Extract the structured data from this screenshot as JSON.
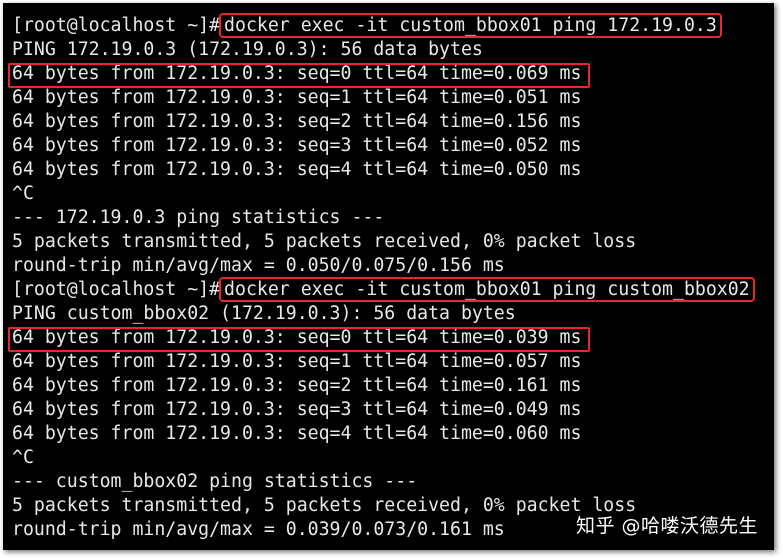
{
  "terminal": {
    "lines": [
      {
        "prompt": "[root@localhost ~]#",
        "command": "docker exec -it custom_bbox01 ping 172.19.0.3"
      },
      {
        "text": "PING 172.19.0.3 (172.19.0.3): 56 data bytes"
      },
      {
        "text": "64 bytes from 172.19.0.3: seq=0 ttl=64 time=0.069 ms"
      },
      {
        "text": "64 bytes from 172.19.0.3: seq=1 ttl=64 time=0.051 ms"
      },
      {
        "text": "64 bytes from 172.19.0.3: seq=2 ttl=64 time=0.156 ms"
      },
      {
        "text": "64 bytes from 172.19.0.3: seq=3 ttl=64 time=0.052 ms"
      },
      {
        "text": "64 bytes from 172.19.0.3: seq=4 ttl=64 time=0.050 ms"
      },
      {
        "text": "^C"
      },
      {
        "text": "--- 172.19.0.3 ping statistics ---"
      },
      {
        "text": "5 packets transmitted, 5 packets received, 0% packet loss"
      },
      {
        "text": "round-trip min/avg/max = 0.050/0.075/0.156 ms"
      },
      {
        "prompt": "[root@localhost ~]#",
        "command": "docker exec -it custom_bbox01 ping custom_bbox02"
      },
      {
        "text": "PING custom_bbox02 (172.19.0.3): 56 data bytes"
      },
      {
        "text": "64 bytes from 172.19.0.3: seq=0 ttl=64 time=0.039 ms"
      },
      {
        "text": "64 bytes from 172.19.0.3: seq=1 ttl=64 time=0.057 ms"
      },
      {
        "text": "64 bytes from 172.19.0.3: seq=2 ttl=64 time=0.161 ms"
      },
      {
        "text": "64 bytes from 172.19.0.3: seq=3 ttl=64 time=0.049 ms"
      },
      {
        "text": "64 bytes from 172.19.0.3: seq=4 ttl=64 time=0.060 ms"
      },
      {
        "text": "^C"
      },
      {
        "text": "--- custom_bbox02 ping statistics ---"
      },
      {
        "text": "5 packets transmitted, 5 packets received, 0% packet loss"
      },
      {
        "text": "round-trip min/avg/max = 0.039/0.073/0.161 ms"
      }
    ]
  },
  "watermark": "知乎 @哈喽沃德先生",
  "colors": {
    "background": "#000000",
    "text": "#e8e8e8",
    "highlight": "#e8262b"
  }
}
